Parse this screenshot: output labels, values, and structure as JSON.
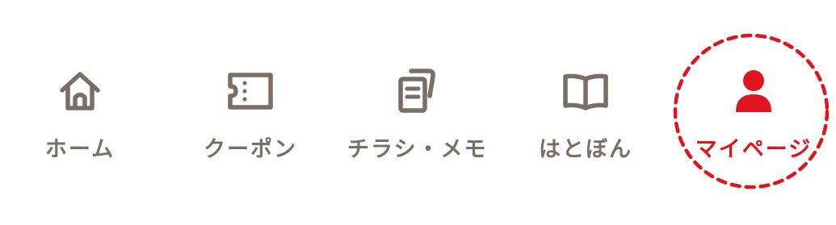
{
  "colors": {
    "icon_inactive": "#7a6f66",
    "active": "#e0141e",
    "background": "#ffffff"
  },
  "tabbar": {
    "items": [
      {
        "id": "home",
        "label": "ホーム",
        "icon": "home-icon",
        "active": false
      },
      {
        "id": "coupon",
        "label": "クーポン",
        "icon": "ticket-icon",
        "active": false
      },
      {
        "id": "flyer",
        "label": "チラシ・メモ",
        "icon": "documents-icon",
        "active": false
      },
      {
        "id": "book",
        "label": "はとぼん",
        "icon": "book-icon",
        "active": false
      },
      {
        "id": "mypage",
        "label": "マイページ",
        "icon": "person-icon",
        "active": true
      }
    ]
  }
}
